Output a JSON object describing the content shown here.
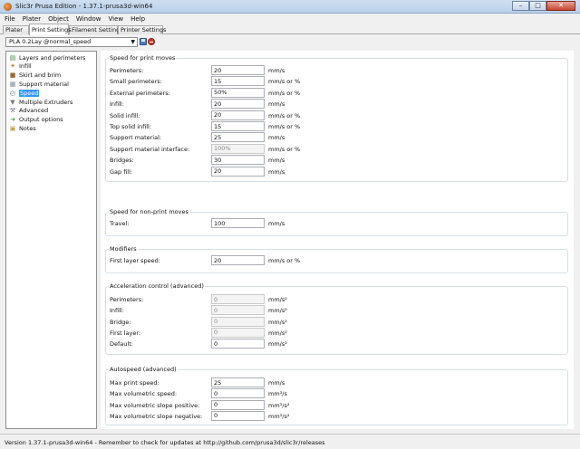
{
  "window": {
    "title": "Slic3r Prusa Edition - 1.37.1-prusa3d-win64",
    "minimize": "–",
    "maximize": "□",
    "close": "✕"
  },
  "menu": [
    "File",
    "Plater",
    "Object",
    "Window",
    "View",
    "Help"
  ],
  "tabs": [
    {
      "label": "Plater",
      "active": false
    },
    {
      "label": "Print Settings",
      "active": true
    },
    {
      "label": "Filament Settings",
      "active": false
    },
    {
      "label": "Printer Settings",
      "active": false
    }
  ],
  "preset": {
    "value": "PLA 0.2Lay @normal_speed",
    "arrow": "▼"
  },
  "sidebar": {
    "items": [
      {
        "label": "Layers and perimeters",
        "icon": "layers-icon",
        "glyph": "▤",
        "color": "#3a8a3a",
        "selected": false
      },
      {
        "label": "Infill",
        "icon": "infill-icon",
        "glyph": "✦",
        "color": "#d07a1a",
        "selected": false
      },
      {
        "label": "Skirt and brim",
        "icon": "skirt-icon",
        "glyph": "■",
        "color": "#9a6a30",
        "selected": false
      },
      {
        "label": "Support material",
        "icon": "support-icon",
        "glyph": "▦",
        "color": "#7a8a9a",
        "selected": false
      },
      {
        "label": "Speed",
        "icon": "speed-icon",
        "glyph": "◴",
        "color": "#5a6a8a",
        "selected": true
      },
      {
        "label": "Multiple Extruders",
        "icon": "extruder-icon",
        "glyph": "▼",
        "color": "#7a7a7a",
        "selected": false
      },
      {
        "label": "Advanced",
        "icon": "wrench-icon",
        "glyph": "⚒",
        "color": "#6a6a9a",
        "selected": false
      },
      {
        "label": "Output options",
        "icon": "output-icon",
        "glyph": "➔",
        "color": "#3a9a3a",
        "selected": false
      },
      {
        "label": "Notes",
        "icon": "notes-icon",
        "glyph": "▣",
        "color": "#c9a23a",
        "selected": false
      }
    ]
  },
  "groups": [
    {
      "title": "Speed for print moves",
      "rows": [
        {
          "label": "Perimeters:",
          "value": "20",
          "unit": "mm/s",
          "disabled": false
        },
        {
          "label": "Small perimeters:",
          "value": "15",
          "unit": "mm/s or %",
          "disabled": false
        },
        {
          "label": "External perimeters:",
          "value": "50%",
          "unit": "mm/s or %",
          "disabled": false
        },
        {
          "label": "Infill:",
          "value": "20",
          "unit": "mm/s",
          "disabled": false
        },
        {
          "label": "Solid infill:",
          "value": "20",
          "unit": "mm/s or %",
          "disabled": false
        },
        {
          "label": "Top solid infill:",
          "value": "15",
          "unit": "mm/s or %",
          "disabled": false
        },
        {
          "label": "Support material:",
          "value": "25",
          "unit": "mm/s",
          "disabled": false
        },
        {
          "label": "Support material interface:",
          "value": "100%",
          "unit": "mm/s or %",
          "disabled": true
        },
        {
          "label": "Bridges:",
          "value": "30",
          "unit": "mm/s",
          "disabled": false
        },
        {
          "label": "Gap fill:",
          "value": "20",
          "unit": "mm/s",
          "disabled": false
        }
      ]
    },
    {
      "title": "Speed for non-print moves",
      "rows": [
        {
          "label": "Travel:",
          "value": "100",
          "unit": "mm/s",
          "disabled": false
        }
      ]
    },
    {
      "title": "Modifiers",
      "rows": [
        {
          "label": "First layer speed:",
          "value": "20",
          "unit": "mm/s or %",
          "disabled": false
        }
      ]
    },
    {
      "title": "Acceleration control (advanced)",
      "rows": [
        {
          "label": "Perimeters:",
          "value": "0",
          "unit": "mm/s²",
          "disabled": true
        },
        {
          "label": "Infill:",
          "value": "0",
          "unit": "mm/s²",
          "disabled": true
        },
        {
          "label": "Bridge:",
          "value": "0",
          "unit": "mm/s²",
          "disabled": true
        },
        {
          "label": "First layer:",
          "value": "0",
          "unit": "mm/s²",
          "disabled": true
        },
        {
          "label": "Default:",
          "value": "0",
          "unit": "mm/s²",
          "disabled": false
        }
      ]
    },
    {
      "title": "Autospeed (advanced)",
      "rows": [
        {
          "label": "Max print speed:",
          "value": "25",
          "unit": "mm/s",
          "disabled": false
        },
        {
          "label": "Max volumetric speed:",
          "value": "0",
          "unit": "mm³/s",
          "disabled": false
        },
        {
          "label": "Max volumetric slope positive:",
          "value": "0",
          "unit": "mm³/s²",
          "disabled": false
        },
        {
          "label": "Max volumetric slope negative:",
          "value": "0",
          "unit": "mm³/s²",
          "disabled": false
        }
      ]
    }
  ],
  "status": "Version 1.37.1-prusa3d-win64 - Remember to check for updates at http://github.com/prusa3d/slic3r/releases"
}
